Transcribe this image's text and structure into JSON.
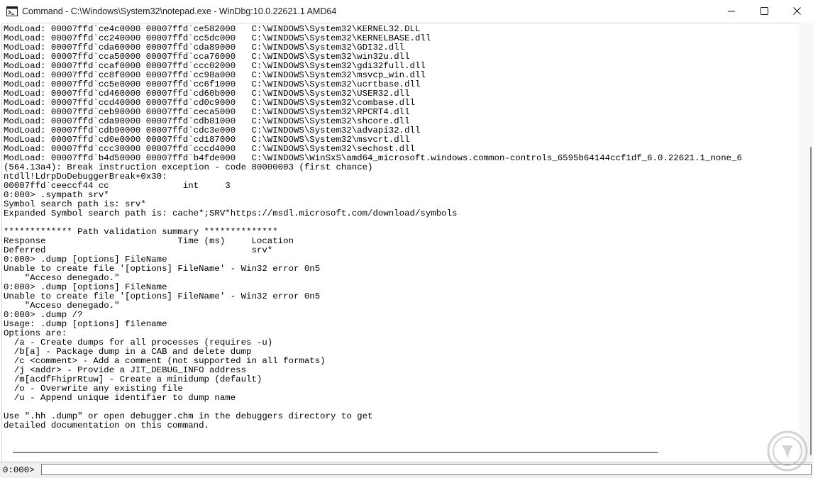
{
  "window": {
    "title": "Command - C:\\Windows\\System32\\notepad.exe - WinDbg:10.0.22621.1 AMD64",
    "minimize_icon": "minimize-icon",
    "maximize_icon": "maximize-icon",
    "close_icon": "close-icon"
  },
  "console": {
    "lines": [
      "ModLoad: 00007ffd`ce4c0000 00007ffd`ce582000   C:\\WINDOWS\\System32\\KERNEL32.DLL",
      "ModLoad: 00007ffd`cc240000 00007ffd`cc5dc000   C:\\WINDOWS\\System32\\KERNELBASE.dll",
      "ModLoad: 00007ffd`cda60000 00007ffd`cda89000   C:\\WINDOWS\\System32\\GDI32.dll",
      "ModLoad: 00007ffd`cca50000 00007ffd`cca76000   C:\\WINDOWS\\System32\\win32u.dll",
      "ModLoad: 00007ffd`ccaf0000 00007ffd`ccc02000   C:\\WINDOWS\\System32\\gdi32full.dll",
      "ModLoad: 00007ffd`cc8f0000 00007ffd`cc98a000   C:\\WINDOWS\\System32\\msvcp_win.dll",
      "ModLoad: 00007ffd`cc5e0000 00007ffd`cc6f1000   C:\\WINDOWS\\System32\\ucrtbase.dll",
      "ModLoad: 00007ffd`cd460000 00007ffd`cd60b000   C:\\WINDOWS\\System32\\USER32.dll",
      "ModLoad: 00007ffd`ccd40000 00007ffd`cd0c9000   C:\\WINDOWS\\System32\\combase.dll",
      "ModLoad: 00007ffd`ceb90000 00007ffd`ceca5000   C:\\WINDOWS\\System32\\RPCRT4.dll",
      "ModLoad: 00007ffd`cda90000 00007ffd`cdb81000   C:\\WINDOWS\\System32\\shcore.dll",
      "ModLoad: 00007ffd`cdb90000 00007ffd`cdc3e000   C:\\WINDOWS\\System32\\advapi32.dll",
      "ModLoad: 00007ffd`cd0e0000 00007ffd`cd187000   C:\\WINDOWS\\System32\\msvcrt.dll",
      "ModLoad: 00007ffd`ccc30000 00007ffd`cccd4000   C:\\WINDOWS\\System32\\sechost.dll",
      "ModLoad: 00007ffd`b4d50000 00007ffd`b4fde000   C:\\WINDOWS\\WinSxS\\amd64_microsoft.windows.common-controls_6595b64144ccf1df_6.0.22621.1_none_6",
      "(564.13a4): Break instruction exception - code 80000003 (first chance)",
      "ntdll!LdrpDoDebuggerBreak+0x30:",
      "00007ffd`ceeccf44 cc              int     3",
      "0:000> .sympath srv*",
      "Symbol search path is: srv*",
      "Expanded Symbol search path is: cache*;SRV*https://msdl.microsoft.com/download/symbols",
      "",
      "************* Path validation summary **************",
      "Response                         Time (ms)     Location",
      "Deferred                                       srv*",
      "0:000> .dump [options] FileName",
      "Unable to create file '[options] FileName' - Win32 error 0n5",
      "    \"Acceso denegado.\"",
      "0:000> .dump [options] FileName",
      "Unable to create file '[options] FileName' - Win32 error 0n5",
      "    \"Acceso denegado.\"",
      "0:000> .dump /?",
      "Usage: .dump [options] filename",
      "Options are:",
      "  /a - Create dumps for all processes (requires -u)",
      "  /b[a] - Package dump in a CAB and delete dump",
      "  /c <comment> - Add a comment (not supported in all formats)",
      "  /j <addr> - Provide a JIT_DEBUG_INFO address",
      "  /m[acdfFhiprRtuw] - Create a minidump (default)",
      "  /o - Overwrite any existing file",
      "  /u - Append unique identifier to dump name",
      "",
      "Use \".hh .dump\" or open debugger.chm in the debuggers directory to get",
      "detailed documentation on this command."
    ]
  },
  "command_bar": {
    "prompt": "0:000>",
    "input_value": ""
  },
  "colors": {
    "background": "#ffffff",
    "text": "#000000",
    "scrollbar": "#8a8a8a"
  }
}
